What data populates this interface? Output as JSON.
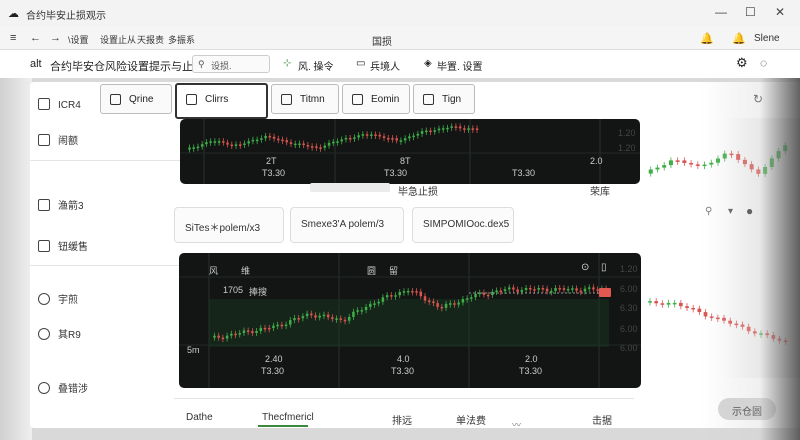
{
  "window": {
    "title": "合约毕安止损观示",
    "minimize_glyph": "—",
    "maximize_glyph": "☐",
    "close_glyph": "✕"
  },
  "nav": {
    "back_glyph": "←",
    "forward_glyph": "→",
    "tabs": [
      "\\设置",
      "设置止从",
      "天报责",
      "多振系"
    ],
    "center_title": "国损",
    "user_name": "Slene"
  },
  "toolbar": {
    "prefix": "alt",
    "title": "合约毕安仓风险设置提示与止损",
    "search_placeholder": "设损.",
    "actions": [
      "风. 操令",
      "兵境人",
      "毕置. 设置"
    ]
  },
  "sidebar": {
    "items": [
      {
        "label": "ICR4",
        "icon": "check-square-icon"
      },
      {
        "label": "闹额",
        "icon": "document-icon"
      },
      {
        "label": "渔箭3",
        "icon": "add-box-icon"
      },
      {
        "label": "钮缓售",
        "icon": "chart-box-icon"
      },
      {
        "label": "宇煎",
        "icon": "person-icon"
      },
      {
        "label": "其R9",
        "icon": "clock-icon"
      },
      {
        "label": "叠错涉",
        "icon": "clock-icon"
      }
    ]
  },
  "tabs": [
    {
      "label": "Qrine",
      "icon": "hand-icon"
    },
    {
      "label": "Clirrs",
      "icon": "bell-icon"
    },
    {
      "label": "Titmn",
      "icon": "cube-icon"
    },
    {
      "label": "Eomin",
      "icon": "back-arrow-icon"
    },
    {
      "label": "Tign",
      "icon": "settings-box-icon"
    }
  ],
  "chart1": {
    "ticks": [
      "2T",
      "8T",
      "2.0"
    ],
    "subticks": [
      "T3.30",
      "T3.30",
      "T3.30"
    ],
    "under_label": "毕急止损",
    "right_label": "荣库",
    "right_axis": [
      "1.20",
      "1.20",
      "1.20",
      "1.20"
    ]
  },
  "cards": [
    "SiTes＊polem/x3",
    "Smexe3'A polem/3",
    "SIMPOMIOoc.dex5"
  ],
  "chart2": {
    "header_a": "风",
    "header_b": "维",
    "header_c": "圆",
    "header_d": "留",
    "price_label": "1705",
    "price_tag": "捧搜",
    "side_label": "5m",
    "ticks": [
      "2.40",
      "4.0",
      "2.0"
    ],
    "subticks": [
      "T3.30",
      "T3.30",
      "T3.30"
    ],
    "right_axis": [
      "1.20",
      "6.00",
      "6.30",
      "6.00",
      "6.00"
    ]
  },
  "footer": {
    "cols": [
      "Dathe",
      "Thecfmericl",
      "排远",
      "单法费",
      "击据"
    ],
    "show_button": "示仓圆"
  },
  "colors": {
    "up": "#3fae49",
    "down": "#d9534f",
    "chart_bg": "#121514"
  },
  "chart_data": [
    {
      "type": "candlestick",
      "title": "",
      "categories": [
        "2T",
        "8T",
        "2.0"
      ],
      "values": [
        1.18,
        1.22,
        1.2,
        1.24,
        1.21,
        1.19,
        1.23,
        1.25,
        1.22,
        1.26,
        1.28,
        1.27
      ]
    },
    {
      "type": "candlestick",
      "title": "",
      "categories": [
        "2.40",
        "4.0",
        "2.0"
      ],
      "values": [
        5.2,
        5.3,
        5.4,
        5.6,
        5.5,
        5.8,
        6.0,
        5.7,
        5.9,
        6.0,
        6.0,
        6.0,
        6.0
      ]
    }
  ]
}
